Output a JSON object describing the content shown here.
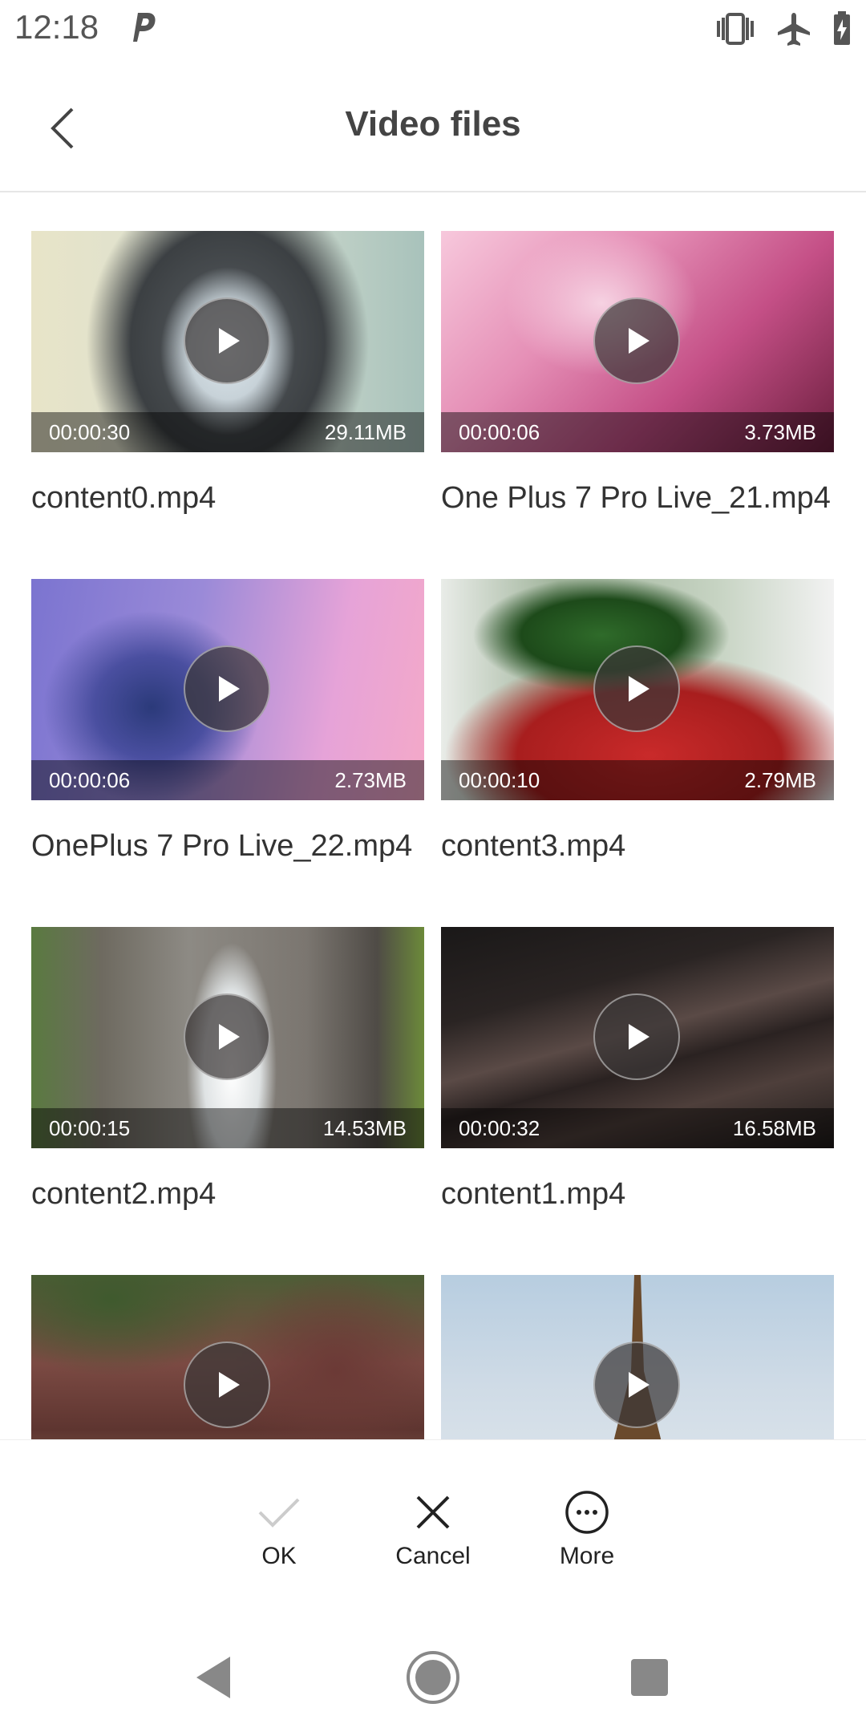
{
  "status_bar": {
    "time": "12:18",
    "icons": [
      "p-notification-icon",
      "vibrate-icon",
      "airplane-mode-icon",
      "battery-charging-icon"
    ]
  },
  "header": {
    "title": "Video files",
    "back_icon": "back-chevron-icon"
  },
  "videos": [
    {
      "name": "content0.mp4",
      "duration": "00:00:30",
      "size": "29.11MB",
      "thumb": "cat"
    },
    {
      "name": "One Plus 7 Pro Live_21.mp4",
      "duration": "00:00:06",
      "size": "3.73MB",
      "thumb": "pink-swirl"
    },
    {
      "name": "OnePlus 7 Pro Live_22.mp4",
      "duration": "00:00:06",
      "size": "2.73MB",
      "thumb": "purple-smoke"
    },
    {
      "name": "content3.mp4",
      "duration": "00:00:10",
      "size": "2.79MB",
      "thumb": "strawberry"
    },
    {
      "name": "content2.mp4",
      "duration": "00:00:15",
      "size": "14.53MB",
      "thumb": "waterfall"
    },
    {
      "name": "content1.mp4",
      "duration": "00:00:32",
      "size": "16.58MB",
      "thumb": "dark-fabric"
    },
    {
      "name": "",
      "duration": "",
      "size": "",
      "thumb": "red-rocks"
    },
    {
      "name": "",
      "duration": "",
      "size": "",
      "thumb": "eiffel"
    }
  ],
  "actions": {
    "ok": {
      "label": "OK",
      "icon": "checkmark-icon",
      "enabled": false
    },
    "cancel": {
      "label": "Cancel",
      "icon": "close-icon"
    },
    "more": {
      "label": "More",
      "icon": "more-dots-icon"
    }
  },
  "nav": {
    "back_icon": "nav-back-icon",
    "home_icon": "nav-home-icon",
    "recents_icon": "nav-recents-icon"
  },
  "colors": {
    "title": "#444444",
    "text": "#333333",
    "disabled_icon": "#cccccc",
    "nav_icon": "#888888"
  }
}
